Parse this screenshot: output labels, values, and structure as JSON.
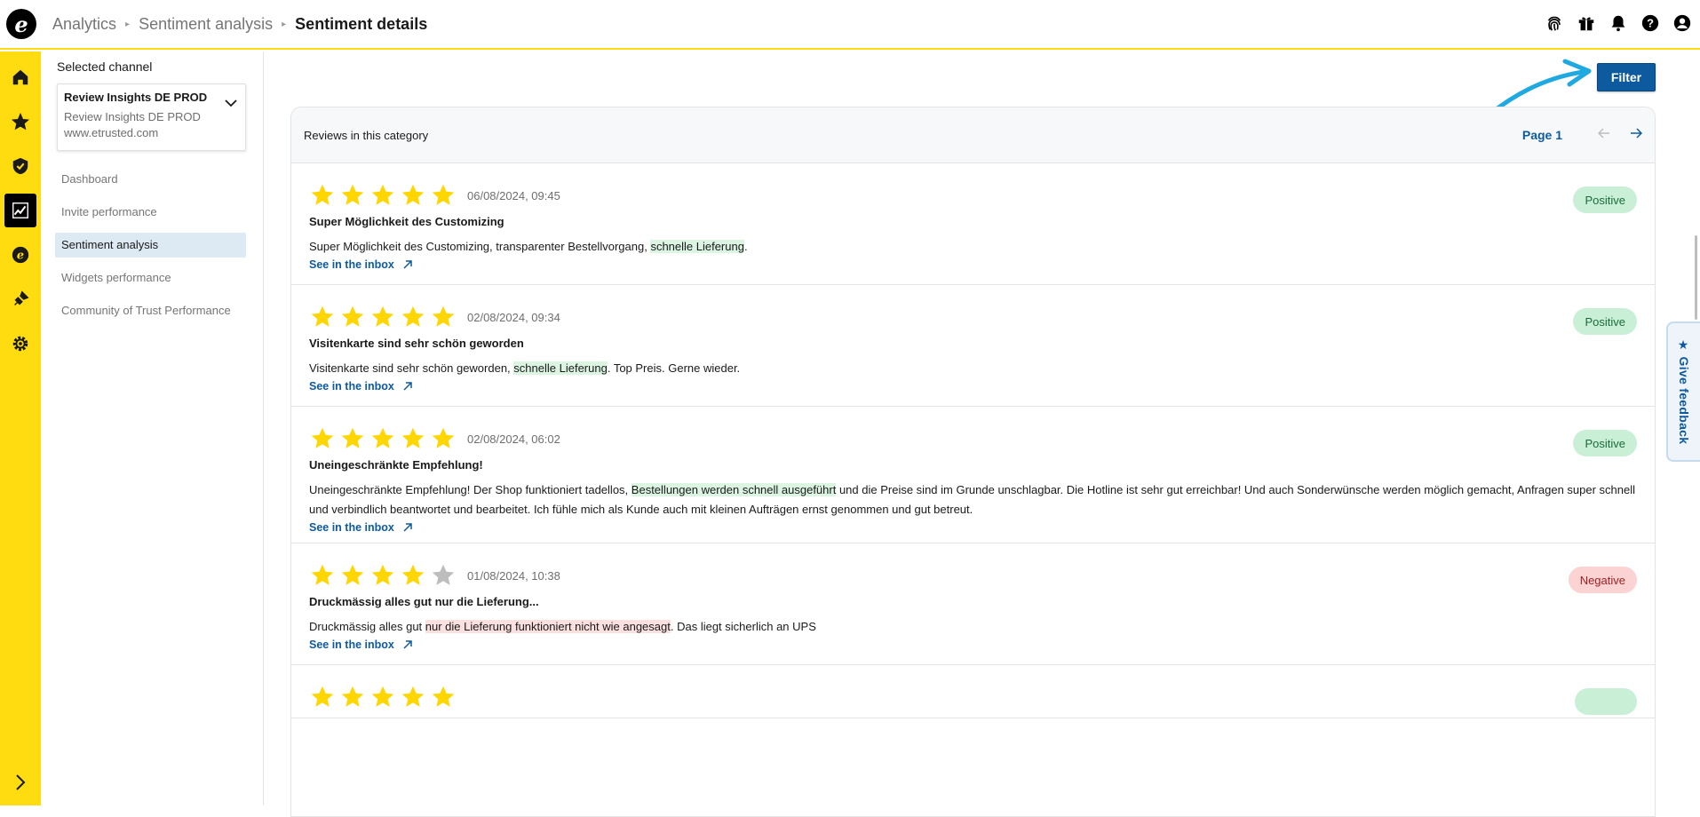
{
  "header": {
    "breadcrumbs": [
      "Analytics",
      "Sentiment analysis"
    ],
    "current": "Sentiment details",
    "logo_letter": "e",
    "icons": [
      "fingerprint-icon",
      "gift-icon",
      "bell-icon",
      "help-icon",
      "account-icon"
    ]
  },
  "rail": {
    "items": [
      "home-icon",
      "star-icon",
      "shield-check-icon",
      "analytics-icon",
      "coin-icon",
      "plug-icon",
      "gear-icon"
    ],
    "active": "analytics-icon"
  },
  "sidebar": {
    "selected_label": "Selected channel",
    "channel": {
      "name": "Review Insights DE PROD",
      "sub1": "Review Insights DE PROD",
      "sub2": "www.etrusted.com"
    },
    "nav": [
      {
        "label": "Dashboard",
        "active": false
      },
      {
        "label": "Invite performance",
        "active": false
      },
      {
        "label": "Sentiment analysis",
        "active": true
      },
      {
        "label": "Widgets performance",
        "active": false
      },
      {
        "label": "Community of Trust Performance",
        "active": false
      }
    ]
  },
  "main": {
    "filter_label": "Filter",
    "card_title": "Reviews in this category",
    "page_label": "Page 1",
    "inbox_link": "See in the inbox",
    "reviews": [
      {
        "stars": 5,
        "date": "06/08/2024, 09:45",
        "title": "Super Möglichkeit des Customizing",
        "text_before": "Super Möglichkeit des Customizing, transparenter Bestellvorgang,",
        "highlight": "schnelle Lieferung",
        "text_after": ".",
        "sentiment": "Positive"
      },
      {
        "stars": 5,
        "date": "02/08/2024, 09:34",
        "title": "Visitenkarte sind sehr schön geworden",
        "text_before": "Visitenkarte sind sehr schön geworden,",
        "highlight": "schnelle Lieferung",
        "text_after": ". Top Preis. Gerne wieder.",
        "sentiment": "Positive"
      },
      {
        "stars": 5,
        "date": "02/08/2024, 06:02",
        "title": "Uneingeschränkte Empfehlung!",
        "text_before": "Uneingeschränkte Empfehlung! Der Shop funktioniert tadellos,",
        "highlight": "Bestellungen werden schnell ausgeführt",
        "text_after": " und die Preise sind im Grunde unschlagbar. Die Hotline ist sehr gut erreichbar! Und auch Sonderwünsche werden möglich gemacht, Anfragen super schnell und verbindlich beantwortet und bearbeitet. Ich fühle mich als Kunde auch mit kleinen Aufträgen ernst genommen und gut betreut.",
        "sentiment": "Positive"
      },
      {
        "stars": 4,
        "date": "01/08/2024, 10:38",
        "title": "Druckmässig alles gut nur die Lieferung...",
        "text_before": "Druckmässig alles gut",
        "highlight": "nur die Lieferung funktioniert nicht wie angesagt",
        "text_after": ". Das liegt sicherlich an UPS",
        "sentiment": "Negative"
      }
    ]
  },
  "feedback": {
    "label": "Give feedback"
  },
  "colors": {
    "brand_yellow": "#ffdc0f",
    "primary_blue": "#0d5a9e",
    "star_yellow": "#ffd600",
    "star_gray": "#bdbdbd",
    "positive_bg": "#c9f0d6",
    "negative_bg": "#fbd3d3"
  }
}
